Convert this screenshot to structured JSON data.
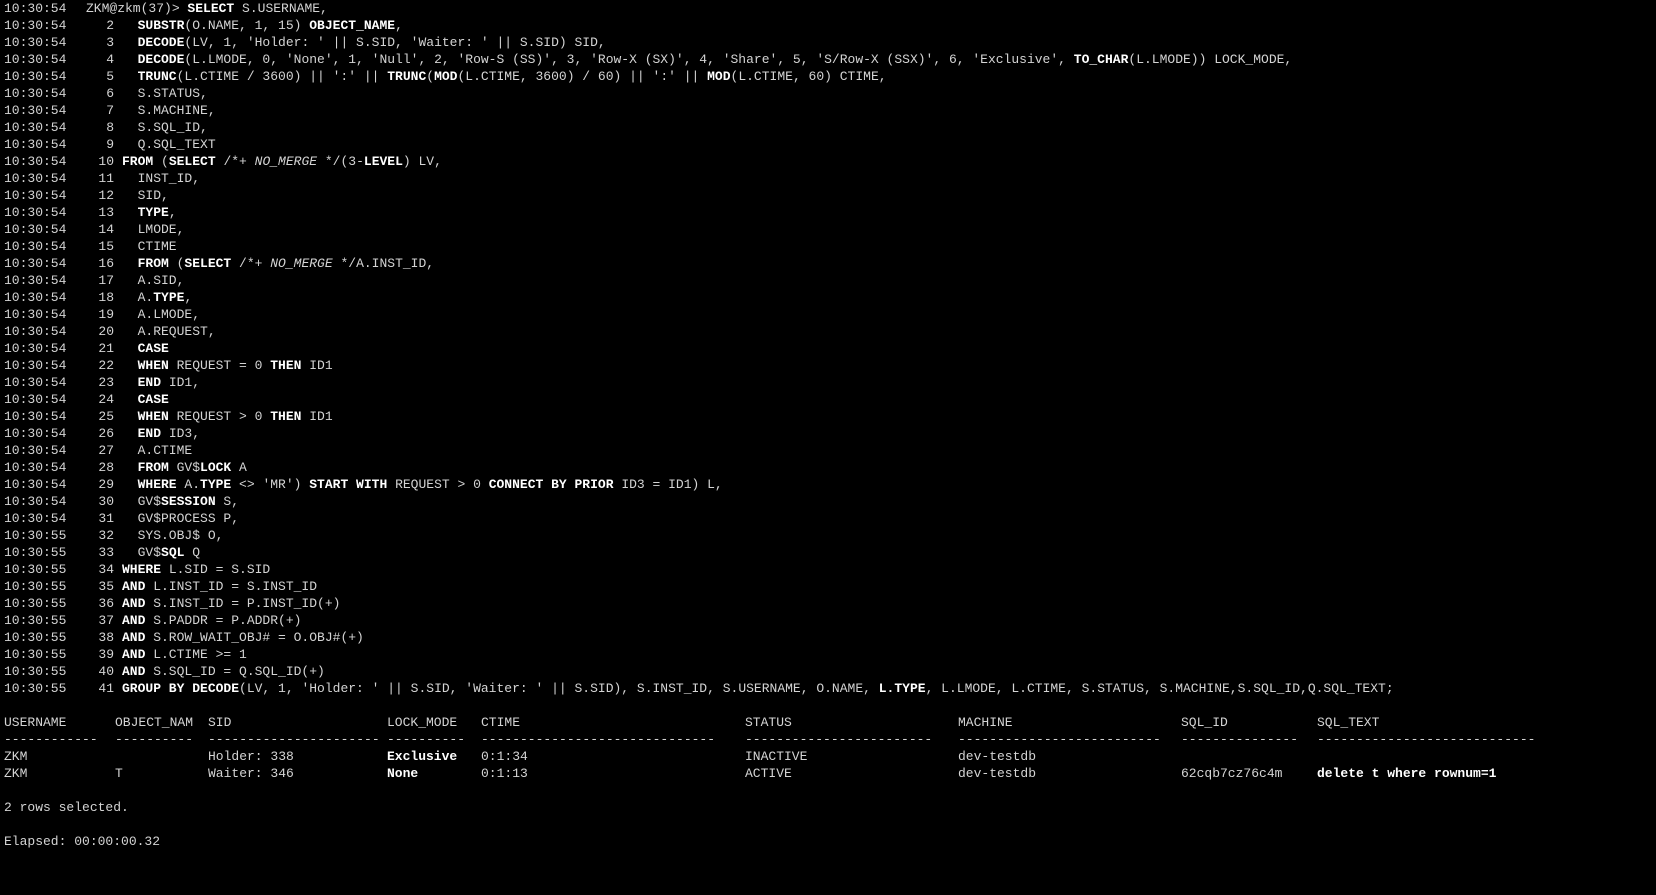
{
  "prompt": "ZKM@zkm(37)> ",
  "lines": [
    {
      "ts": "10:30:54",
      "no": "",
      "code": [
        [
          "SELECT",
          "k"
        ],
        [
          " S.USERNAME,",
          ""
        ]
      ]
    },
    {
      "ts": "10:30:54",
      "no": "2",
      "code": [
        [
          "  SUBSTR",
          "k"
        ],
        [
          "(O.NAME, 1, 15) ",
          ""
        ],
        [
          "OBJECT_NAME",
          "k"
        ],
        [
          ",",
          ""
        ]
      ]
    },
    {
      "ts": "10:30:54",
      "no": "3",
      "code": [
        [
          "  DECODE",
          "k"
        ],
        [
          "(LV, 1, 'Holder: ' || S.SID, 'Waiter: ' || S.SID) SID,",
          ""
        ]
      ]
    },
    {
      "ts": "10:30:54",
      "no": "4",
      "code": [
        [
          "  DECODE",
          "k"
        ],
        [
          "(L.LMODE, 0, 'None', 1, 'Null', 2, 'Row-S (SS)', 3, 'Row-X (SX)', 4, 'Share', 5, 'S/Row-X (SSX)', 6, 'Exclusive', ",
          ""
        ],
        [
          "TO_CHAR",
          "k"
        ],
        [
          "(L.LMODE)) LOCK_MODE,",
          ""
        ]
      ]
    },
    {
      "ts": "10:30:54",
      "no": "5",
      "code": [
        [
          "  TRUNC",
          "k"
        ],
        [
          "(L.CTIME / 3600) || ':' || ",
          ""
        ],
        [
          "TRUNC",
          "k"
        ],
        [
          "(",
          ""
        ],
        [
          "MOD",
          "k"
        ],
        [
          "(L.CTIME, 3600) / 60) || ':' || ",
          ""
        ],
        [
          "MOD",
          "k"
        ],
        [
          "(L.CTIME, 60) CTIME,",
          ""
        ]
      ]
    },
    {
      "ts": "10:30:54",
      "no": "6",
      "code": [
        [
          "  S.STATUS,",
          ""
        ]
      ]
    },
    {
      "ts": "10:30:54",
      "no": "7",
      "code": [
        [
          "  S.MACHINE,",
          ""
        ]
      ]
    },
    {
      "ts": "10:30:54",
      "no": "8",
      "code": [
        [
          "  S.SQL_ID,",
          ""
        ]
      ]
    },
    {
      "ts": "10:30:54",
      "no": "9",
      "code": [
        [
          "  Q.SQL_TEXT",
          ""
        ]
      ]
    },
    {
      "ts": "10:30:54",
      "no": "10",
      "code": [
        [
          "FROM",
          "k"
        ],
        [
          " (",
          ""
        ],
        [
          "SELECT",
          "k"
        ],
        [
          " /*+ ",
          ""
        ],
        [
          "NO_MERGE",
          "h"
        ],
        [
          " */(3-",
          ""
        ],
        [
          "LEVEL",
          "k"
        ],
        [
          ") LV,",
          ""
        ]
      ]
    },
    {
      "ts": "10:30:54",
      "no": "11",
      "code": [
        [
          "  INST_ID,",
          ""
        ]
      ]
    },
    {
      "ts": "10:30:54",
      "no": "12",
      "code": [
        [
          "  SID,",
          ""
        ]
      ]
    },
    {
      "ts": "10:30:54",
      "no": "13",
      "code": [
        [
          "  TYPE",
          "k"
        ],
        [
          ",",
          ""
        ]
      ]
    },
    {
      "ts": "10:30:54",
      "no": "14",
      "code": [
        [
          "  LMODE,",
          ""
        ]
      ]
    },
    {
      "ts": "10:30:54",
      "no": "15",
      "code": [
        [
          "  CTIME",
          ""
        ]
      ]
    },
    {
      "ts": "10:30:54",
      "no": "16",
      "code": [
        [
          "  FROM",
          "k"
        ],
        [
          " (",
          ""
        ],
        [
          "SELECT",
          "k"
        ],
        [
          " /*+ ",
          ""
        ],
        [
          "NO_MERGE",
          "h"
        ],
        [
          " */A.INST_ID,",
          ""
        ]
      ]
    },
    {
      "ts": "10:30:54",
      "no": "17",
      "code": [
        [
          "  A.SID,",
          ""
        ]
      ]
    },
    {
      "ts": "10:30:54",
      "no": "18",
      "code": [
        [
          "  A.",
          ""
        ],
        [
          "TYPE",
          "k"
        ],
        [
          ",",
          ""
        ]
      ]
    },
    {
      "ts": "10:30:54",
      "no": "19",
      "code": [
        [
          "  A.LMODE,",
          ""
        ]
      ]
    },
    {
      "ts": "10:30:54",
      "no": "20",
      "code": [
        [
          "  A.REQUEST,",
          ""
        ]
      ]
    },
    {
      "ts": "10:30:54",
      "no": "21",
      "code": [
        [
          "  CASE",
          "k"
        ]
      ]
    },
    {
      "ts": "10:30:54",
      "no": "22",
      "code": [
        [
          "  WHEN",
          "k"
        ],
        [
          " REQUEST = 0 ",
          ""
        ],
        [
          "THEN",
          "k"
        ],
        [
          " ID1",
          ""
        ]
      ]
    },
    {
      "ts": "10:30:54",
      "no": "23",
      "code": [
        [
          "  END",
          "k"
        ],
        [
          " ID1,",
          ""
        ]
      ]
    },
    {
      "ts": "10:30:54",
      "no": "24",
      "code": [
        [
          "  CASE",
          "k"
        ]
      ]
    },
    {
      "ts": "10:30:54",
      "no": "25",
      "code": [
        [
          "  WHEN",
          "k"
        ],
        [
          " REQUEST > 0 ",
          ""
        ],
        [
          "THEN",
          "k"
        ],
        [
          " ID1",
          ""
        ]
      ]
    },
    {
      "ts": "10:30:54",
      "no": "26",
      "code": [
        [
          "  END",
          "k"
        ],
        [
          " ID3,",
          ""
        ]
      ]
    },
    {
      "ts": "10:30:54",
      "no": "27",
      "code": [
        [
          "  A.CTIME",
          ""
        ]
      ]
    },
    {
      "ts": "10:30:54",
      "no": "28",
      "code": [
        [
          "  FROM",
          "k"
        ],
        [
          " GV$",
          ""
        ],
        [
          "LOCK",
          "k"
        ],
        [
          " A",
          ""
        ]
      ]
    },
    {
      "ts": "10:30:54",
      "no": "29",
      "code": [
        [
          "  WHERE",
          "k"
        ],
        [
          " A.",
          ""
        ],
        [
          "TYPE",
          "k"
        ],
        [
          " <> 'MR') ",
          ""
        ],
        [
          "START WITH",
          "k"
        ],
        [
          " REQUEST > 0 ",
          ""
        ],
        [
          "CONNECT BY PRIOR",
          "k"
        ],
        [
          " ID3 = ID1) L,",
          ""
        ]
      ]
    },
    {
      "ts": "10:30:54",
      "no": "30",
      "code": [
        [
          "  GV$",
          ""
        ],
        [
          "SESSION",
          "k"
        ],
        [
          " S,",
          ""
        ]
      ]
    },
    {
      "ts": "10:30:54",
      "no": "31",
      "code": [
        [
          "  GV$PROCESS P,",
          ""
        ]
      ]
    },
    {
      "ts": "10:30:55",
      "no": "32",
      "code": [
        [
          "  SYS.OBJ$ O,",
          ""
        ]
      ]
    },
    {
      "ts": "10:30:55",
      "no": "33",
      "code": [
        [
          "  GV$",
          ""
        ],
        [
          "SQL",
          "k"
        ],
        [
          " Q",
          ""
        ]
      ]
    },
    {
      "ts": "10:30:55",
      "no": "34",
      "code": [
        [
          "WHERE",
          "k"
        ],
        [
          " L.SID = S.SID",
          ""
        ]
      ]
    },
    {
      "ts": "10:30:55",
      "no": "35",
      "code": [
        [
          "AND",
          "k"
        ],
        [
          " L.INST_ID = S.INST_ID",
          ""
        ]
      ]
    },
    {
      "ts": "10:30:55",
      "no": "36",
      "code": [
        [
          "AND",
          "k"
        ],
        [
          " S.INST_ID = P.INST_ID(+)",
          ""
        ]
      ]
    },
    {
      "ts": "10:30:55",
      "no": "37",
      "code": [
        [
          "AND",
          "k"
        ],
        [
          " S.PADDR = P.ADDR(+)",
          ""
        ]
      ]
    },
    {
      "ts": "10:30:55",
      "no": "38",
      "code": [
        [
          "AND",
          "k"
        ],
        [
          " S.ROW_WAIT_OBJ# = O.OBJ#(+)",
          ""
        ]
      ]
    },
    {
      "ts": "10:30:55",
      "no": "39",
      "code": [
        [
          "AND",
          "k"
        ],
        [
          " L.CTIME >= 1",
          ""
        ]
      ]
    },
    {
      "ts": "10:30:55",
      "no": "40",
      "code": [
        [
          "AND",
          "k"
        ],
        [
          " S.SQL_ID = Q.SQL_ID(+)",
          ""
        ]
      ]
    },
    {
      "ts": "10:30:55",
      "no": "41",
      "code": [
        [
          "GROUP BY DECODE",
          "k"
        ],
        [
          "(LV, 1, 'Holder: ' || S.SID, 'Waiter: ' || S.SID), S.INST_ID, S.USERNAME, O.NAME, ",
          ""
        ],
        [
          "L.TYPE",
          "k"
        ],
        [
          ", L.LMODE, L.CTIME, S.STATUS, S.MACHINE,S.SQL_ID,Q.SQL_TEXT;",
          ""
        ]
      ]
    }
  ],
  "result": {
    "headers": [
      "USERNAME",
      "OBJECT_NAM",
      "SID",
      "LOCK_MODE",
      "CTIME",
      "STATUS",
      "MACHINE",
      "SQL_ID",
      "SQL_TEXT"
    ],
    "separators": [
      "------------",
      "----------",
      "----------------------",
      "----------",
      "------------------------------",
      "------------------------",
      "--------------------------",
      "---------------",
      "----------------------------"
    ],
    "rows": [
      [
        "ZKM",
        "",
        "Holder: 338",
        "Exclusive",
        "0:1:34",
        "INACTIVE",
        "dev-testdb",
        "",
        ""
      ],
      [
        "ZKM",
        "T",
        "Waiter: 346",
        "None",
        "0:1:13",
        "ACTIVE",
        "dev-testdb",
        "62cqb7cz76c4m",
        "delete t where rownum=1"
      ]
    ],
    "rows_selected": "2 rows selected.",
    "elapsed": "Elapsed: 00:00:00.32"
  }
}
